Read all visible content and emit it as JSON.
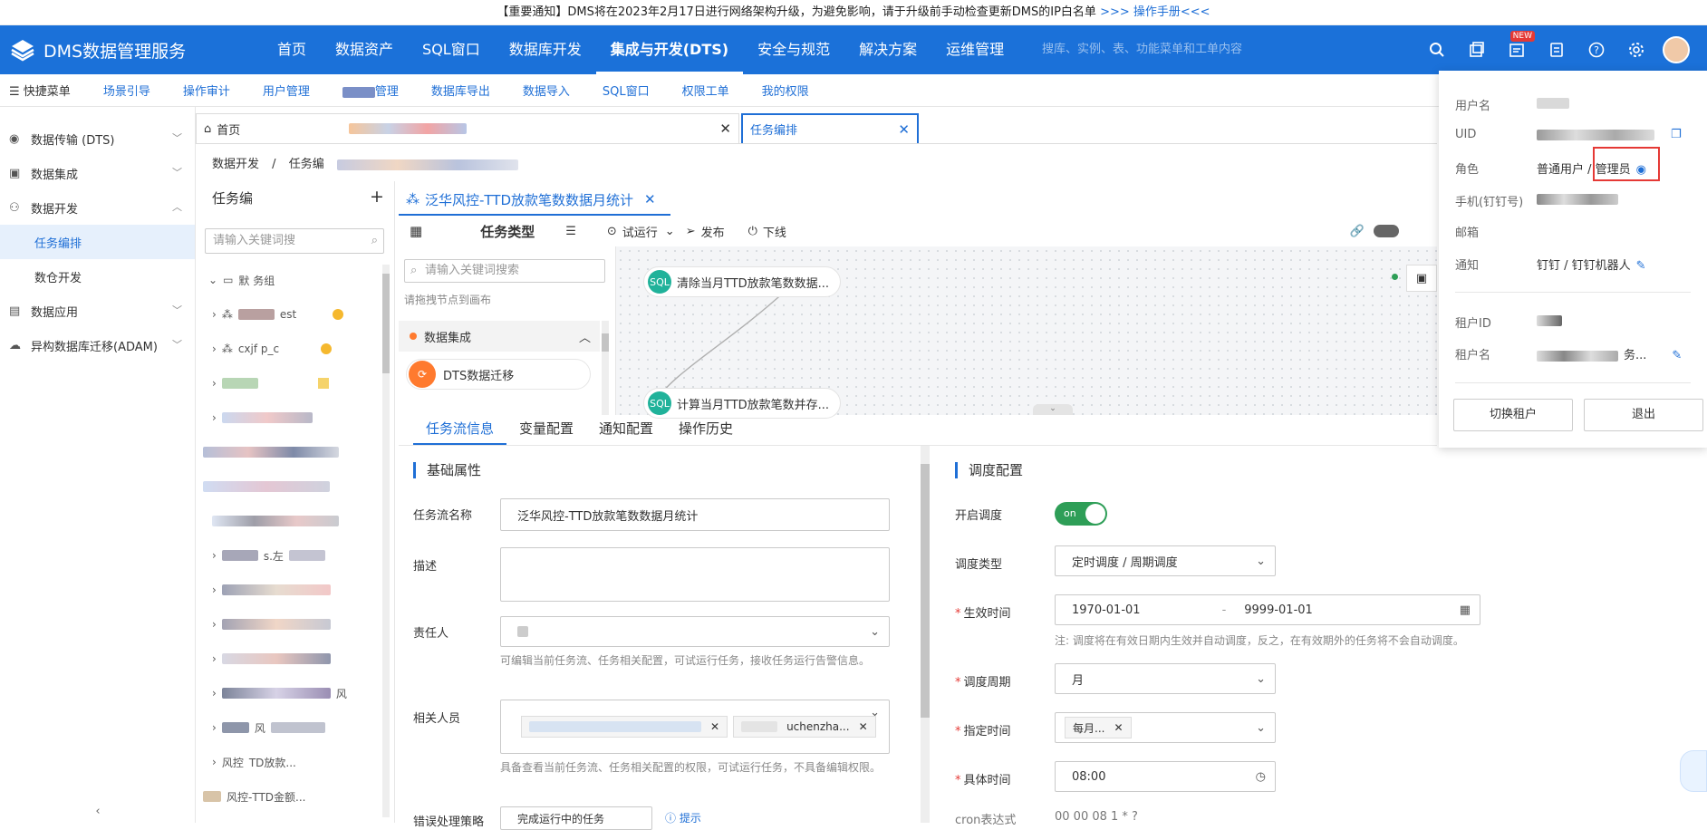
{
  "banner": {
    "text": "【重要通知】DMS将在2023年2月17日进行网络架构升级，为避免影响，请于升级前手动检查更新DMS的IP白名单",
    "link": ">>> 操作手册<<<"
  },
  "app": {
    "title": "DMS数据管理服务"
  },
  "topnav": [
    "首页",
    "数据资产",
    "SQL窗口",
    "数据库开发",
    "集成与开发(DTS)",
    "安全与规范",
    "解决方案",
    "运维管理"
  ],
  "search": {
    "placeholder": "搜库、实例、表、功能菜单和工单内容"
  },
  "badge_new": "NEW",
  "subnav": {
    "menu": "快捷菜单",
    "items": [
      "场景引导",
      "操作审计",
      "用户管理",
      "管理",
      "数据库导出",
      "数据导入",
      "SQL窗口",
      "权限工单",
      "我的权限"
    ]
  },
  "sidebar": {
    "items": [
      {
        "label": "数据传输 (DTS)"
      },
      {
        "label": "数据集成"
      },
      {
        "label": "数据开发"
      },
      {
        "label": "任务编排"
      },
      {
        "label": "数仓开发"
      },
      {
        "label": "数据应用"
      },
      {
        "label": "异构数据库迁移(ADAM)"
      }
    ]
  },
  "tabs": {
    "home": "首页",
    "active": "任务编排"
  },
  "breadcrumb": {
    "a": "数据开发",
    "sep": "/",
    "b": "任务编"
  },
  "tree": {
    "title": "任务编",
    "search_placeholder": "请输入关键词搜",
    "rows": [
      "默 务组",
      "est",
      "cxjf p_c",
      "",
      "",
      "",
      "",
      "",
      "s.左",
      "",
      "",
      "",
      "",
      "风",
      "风",
      "风控",
      "TD放款...",
      "风控-TTD金额...",
      "TD金额..."
    ]
  },
  "canvas_tab": {
    "title": "泛华风控-TTD放款笔数数据月统计"
  },
  "toolbar": {
    "task_type": "任务类型",
    "trial_run": "试运行",
    "publish": "发布",
    "offline": "下线"
  },
  "taskpanel": {
    "search_placeholder": "请输入关键词搜索",
    "drag_hint": "请拖拽节点到画布",
    "group": "数据集成",
    "item": "DTS数据迁移"
  },
  "nodes": [
    {
      "label": "清除当月TTD放款笔数数据..."
    },
    {
      "label": "计算当月TTD放款笔数并存..."
    }
  ],
  "bottom_tabs": [
    "任务流信息",
    "变量配置",
    "通知配置",
    "操作历史"
  ],
  "basic": {
    "title": "基础属性",
    "name_label": "任务流名称",
    "name_value": "泛华风控-TTD放款笔数数据月统计",
    "desc_label": "描述",
    "owner_label": "责任人",
    "owner_hint": "可编辑当前任务流、任务相关配置，可试运行任务，接收任务运行告警信息。",
    "members_label": "相关人员",
    "member_chip": "uchenzha...",
    "members_hint": "具备查看当前任务流、任务相关配置的权限，可试运行任务，不具备编辑权限。",
    "more_label": "错误处理策略",
    "more_value": "完成运行中的任务",
    "more_link": "提示"
  },
  "schedule": {
    "title": "调度配置",
    "enable_label": "开启调度",
    "switch_text": "on",
    "type_label": "调度类型",
    "type_value": "定时调度 / 周期调度",
    "effective_label": "生效时间",
    "start": "1970-01-01",
    "dash": "-",
    "end": "9999-01-01",
    "note": "注: 调度将在有效日期内生效并自动调度，反之，在有效期外的任务将不会自动调度。",
    "cycle_label": "调度周期",
    "cycle_value": "月",
    "specify_label": "指定时间",
    "specify_value": "每月...",
    "time_label": "具体时间",
    "time_value": "08:00",
    "cron_label": "cron表达式",
    "cron_value": "00 00 08 1 * ?"
  },
  "user_popup": {
    "username_label": "用户名",
    "uid_label": "UID",
    "role_label": "角色",
    "role_value": "普通用户 / 管理员",
    "phone_label": "手机(钉钉号)",
    "email_label": "邮箱",
    "notify_label": "通知",
    "notify_value": "钉钉 / 钉钉机器人",
    "tenant_id_label": "租户ID",
    "tenant_name_label": "租户名",
    "tenant_name_value": "务...",
    "switch_tenant": "切换租户",
    "logout": "退出"
  },
  "colors": {
    "primary": "#1b71d9",
    "link": "#1f6fd6",
    "switch_on": "#2e9e57",
    "node_icon": "#20b29a",
    "highlight": "#e53935"
  }
}
